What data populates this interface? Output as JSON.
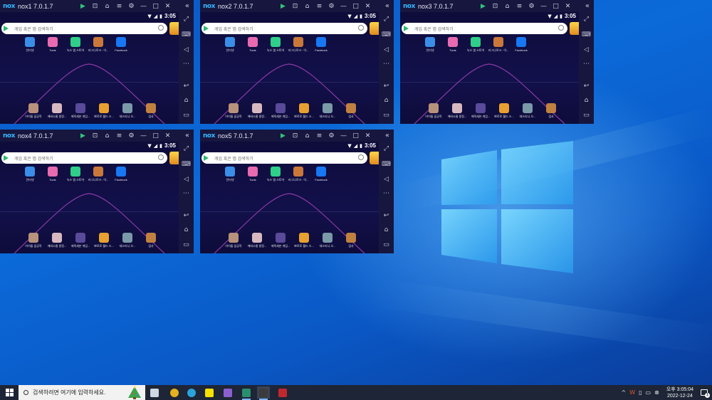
{
  "nox_windows": [
    {
      "title": "nox1 7.0.1.7",
      "time": "3:05"
    },
    {
      "title": "nox2 7.0.1.7",
      "time": "3:05"
    },
    {
      "title": "nox3 7.0.1.7",
      "time": "3:05"
    },
    {
      "title": "nox4 7.0.1.7",
      "time": "3:05"
    },
    {
      "title": "nox5 7.0.1.7",
      "time": "3:05"
    }
  ],
  "nox_common": {
    "logo_text": "nox",
    "search_placeholder": "게임 혹은 앱 검색하기",
    "top_apps": [
      {
        "label": "인터넷",
        "color": "#3a8ee8"
      },
      {
        "label": "Tools",
        "color": "#e86ab0"
      },
      {
        "label": "녹스 앱 스토어",
        "color": "#2fcf8a"
      },
      {
        "label": "러그나로크 : 이...",
        "color": "#c9783a"
      },
      {
        "label": "Facebook",
        "color": "#1877f2"
      }
    ],
    "bottom_apps": [
      {
        "label": "아이돌 꿈공작",
        "color": "#b8927a"
      },
      {
        "label": "에버소울 원정...",
        "color": "#d8b8c0"
      },
      {
        "label": "에픽세븐 게임...",
        "color": "#5a4a9a"
      },
      {
        "label": "뽀로로 월드 스...",
        "color": "#e8a030"
      },
      {
        "label": "데스티니 오...",
        "color": "#7a9aa8"
      },
      {
        "label": "검사",
        "color": "#c08040"
      }
    ]
  },
  "taskbar": {
    "search_placeholder": "검색하려면 여기에 입력하세요.",
    "clock_time": "오후 3:05:04",
    "clock_date": "2022-12-24",
    "notification_count": "1",
    "apps": [
      {
        "name": "task-view",
        "color": "#cfd6e4"
      },
      {
        "name": "chrome",
        "color": "#e3b21f"
      },
      {
        "name": "edge",
        "color": "#2aa3d8"
      },
      {
        "name": "kakaotalk",
        "color": "#f9e000"
      },
      {
        "name": "visual-studio",
        "color": "#8c5fd0"
      },
      {
        "name": "nox-multi",
        "color": "#2a8f6f"
      },
      {
        "name": "nox",
        "color": "#3b3b3b"
      },
      {
        "name": "red-app",
        "color": "#c0282e"
      }
    ]
  }
}
